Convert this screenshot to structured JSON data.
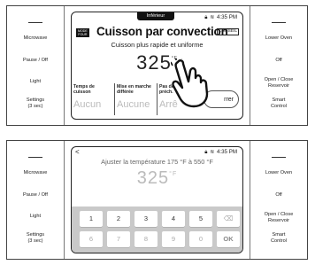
{
  "side_left": {
    "items": [
      "Microwave",
      "Pause / Off",
      "Light",
      "Settings",
      "(3 sec)"
    ]
  },
  "side_right": {
    "items": [
      "Lower Oven",
      "Off",
      "Open / Close",
      "Reservoir",
      "Smart",
      "Control"
    ]
  },
  "screen1": {
    "tab_label": "Inférieur",
    "time": "4:35 PM",
    "mode_badge_line1": "MODE",
    "mode_badge_line2": "FOUR",
    "title": "Cuisson par convection",
    "conseil": "CONSEIL",
    "subtitle": "Cuisson plus rapide et uniforme",
    "temperature": "325",
    "unit": "°F",
    "options": [
      {
        "label_line1": "Temps de",
        "label_line2": "cuisson",
        "value": "Aucun"
      },
      {
        "label_line1": "Mise en marche",
        "label_line2": "différée",
        "value": "Aucune"
      },
      {
        "label_line1": "Pas de",
        "label_line2": "préch.",
        "value": "Arrê"
      }
    ],
    "start_button": "rrer"
  },
  "screen2": {
    "back": "<",
    "time": "4:35 PM",
    "adjust_text": "Ajuster la température 175 °F à 550 °F",
    "temperature": "325",
    "unit": "°F",
    "keys_row1": [
      "1",
      "2",
      "3",
      "4",
      "5",
      "⌫"
    ],
    "keys_row2": [
      "6",
      "7",
      "8",
      "9",
      "0",
      "OK"
    ]
  }
}
